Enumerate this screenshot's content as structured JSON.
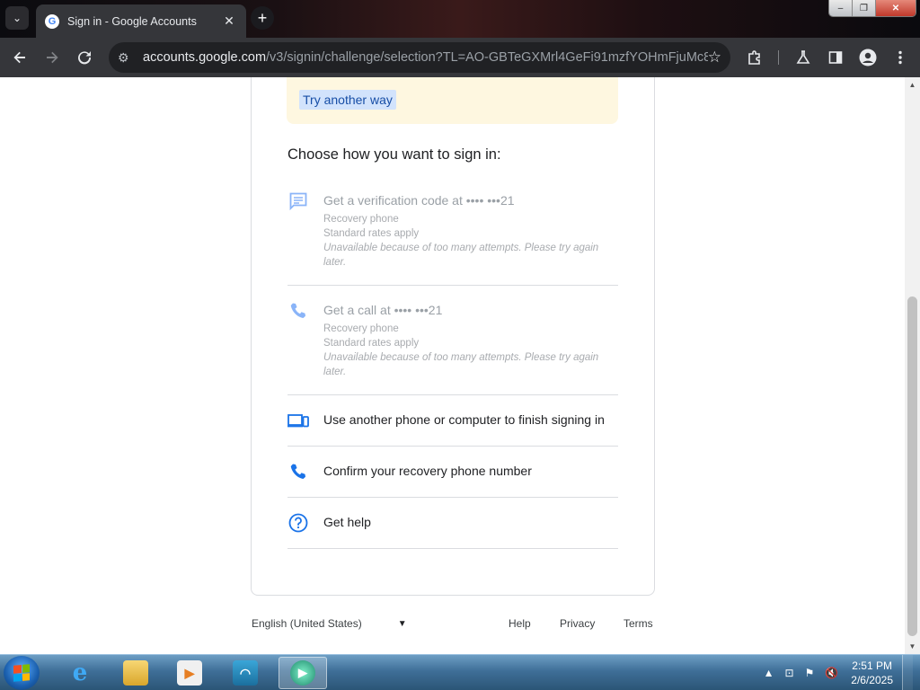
{
  "browser": {
    "tab_title": "Sign in - Google Accounts",
    "url_host": "accounts.google.com",
    "url_path": "/v3/signin/challenge/selection?TL=AO-GBTeGXMrl4GeFi91mzfYOHmFjuMc84...",
    "icons": [
      "tab-search-icon",
      "google-favicon",
      "close-icon",
      "new-tab-icon",
      "back-icon",
      "forward-icon",
      "reload-icon",
      "site-settings-icon",
      "star-icon",
      "extensions-icon",
      "labs-icon",
      "side-panel-icon",
      "profile-icon",
      "menu-icon"
    ]
  },
  "window_controls": {
    "minimize": "–",
    "restore": "❐",
    "close": "✕"
  },
  "page": {
    "try_another_way": "Try another way",
    "heading": "Choose how you want to sign in:",
    "options": [
      {
        "title": "Get a verification code at •••• •••21",
        "line1": "Recovery phone",
        "line2": "Standard rates apply",
        "warning": "Unavailable because of too many attempts. Please try again later.",
        "icon": "sms-icon",
        "disabled": true
      },
      {
        "title": "Get a call at •••• •••21",
        "line1": "Recovery phone",
        "line2": "Standard rates apply",
        "warning": "Unavailable because of too many attempts. Please try again later.",
        "icon": "phone-icon",
        "disabled": true
      },
      {
        "title": "Use another phone or computer to finish signing in",
        "icon": "devices-icon",
        "disabled": false
      },
      {
        "title": "Confirm your recovery phone number",
        "icon": "phone-icon",
        "disabled": false
      },
      {
        "title": "Get help",
        "icon": "help-icon",
        "disabled": false
      }
    ],
    "footer": {
      "language": "English (United States)",
      "help": "Help",
      "privacy": "Privacy",
      "terms": "Terms"
    }
  },
  "colors": {
    "accent": "#1a73e8",
    "notice_bg": "#fef7e0",
    "link_highlight": "#d2e3fc"
  },
  "taskbar": {
    "time": "2:51 PM",
    "date": "2/6/2025",
    "apps": [
      "internet-explorer",
      "file-explorer",
      "media-player",
      "dolphin-app",
      "browser-app"
    ]
  }
}
